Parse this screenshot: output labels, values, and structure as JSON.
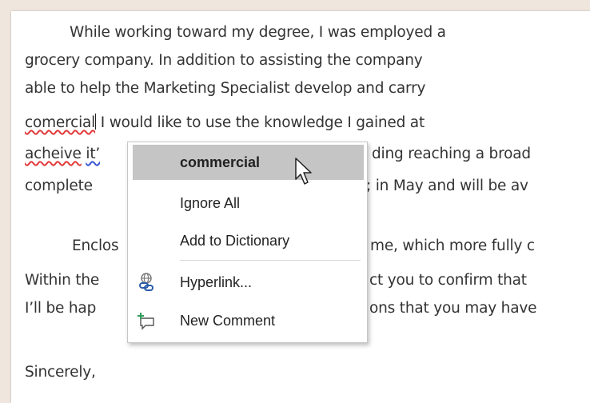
{
  "document": {
    "line1": "While working toward my degree, I was employed a",
    "line2": "grocery company. In addition to assisting the company",
    "line3": "able to help the Marketing Specialist develop and carry",
    "line4_word": "comercial",
    "line4_rest": " I would like to use the knowledge I gained at",
    "line5_word": "acheive",
    "line5_gram": "it’",
    "line5_rest": "ding reaching a broad",
    "line6_start": "complete",
    "line6_rest": "; in May and will be av",
    "line7_start": "Enclos",
    "line7_rest": "me, which more fully c",
    "line8_start": "Within the",
    "line8_rest": "ct you to confirm that",
    "line9_start": "I’ll be hap",
    "line9_rest": "ons that you may have",
    "closing": "Sincerely,"
  },
  "context_menu": {
    "suggestion": "commercial",
    "ignore_all": "Ignore All",
    "add_to_dictionary": "Add to Dictionary",
    "hyperlink": "Hyperlink...",
    "new_comment": "New Comment",
    "icons": [
      "hyperlink-icon",
      "new-comment-icon"
    ]
  },
  "colors": {
    "spelling_underline": "#e23a3a",
    "grammar_underline": "#3a55d6",
    "menu_highlight": "#c5c5c5",
    "hyperlink_icon": "#2b5ca8",
    "comment_icon_plus": "#2e9e5b"
  }
}
